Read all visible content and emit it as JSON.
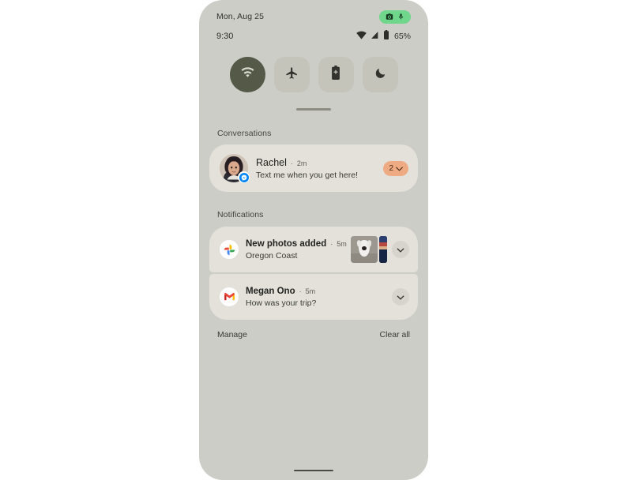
{
  "statusbar": {
    "date": "Mon, Aug 25",
    "clock": "9:30",
    "battery_percent": "65%",
    "privacy_icons": [
      "camera-icon",
      "microphone-icon"
    ],
    "signal_icons": [
      "wifi-icon",
      "cellular-signal-icon",
      "battery-icon"
    ],
    "privacy_pill_color": "#6fd68b"
  },
  "quick_settings": {
    "tiles": [
      {
        "name": "wifi",
        "icon": "wifi-icon",
        "active": true
      },
      {
        "name": "airplane-mode",
        "icon": "airplane-icon",
        "active": false
      },
      {
        "name": "battery-saver",
        "icon": "battery-saver-icon",
        "active": false
      },
      {
        "name": "do-not-disturb",
        "icon": "moon-icon",
        "active": false
      }
    ],
    "active_color": "#545a47",
    "inactive_color": "#c4c4bb"
  },
  "sections": {
    "conversations_label": "Conversations",
    "notifications_label": "Notifications"
  },
  "conversations": [
    {
      "title": "Rachel",
      "separator": "·",
      "time": "2m",
      "body": "Text me when you get here!",
      "count": "2",
      "badge_color": "#eeaa83",
      "app_badge": "messenger-icon"
    }
  ],
  "notifications": [
    {
      "title": "New photos added",
      "separator": "·",
      "time": "5m",
      "body": "Oregon Coast",
      "app_icon": "google-photos-icon",
      "has_thumbnails": true
    },
    {
      "title": "Megan Ono",
      "separator": "·",
      "time": "5m",
      "body": "How was your trip?",
      "app_icon": "gmail-icon",
      "has_thumbnails": false
    }
  ],
  "footer": {
    "manage_label": "Manage",
    "clear_all_label": "Clear all"
  },
  "theme": {
    "screen_background": "#cdcdc8",
    "card_background": "#e3e1da",
    "page_background": "#ffffff"
  }
}
